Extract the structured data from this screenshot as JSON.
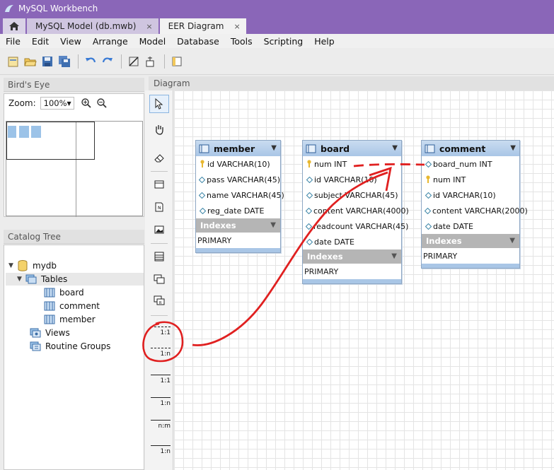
{
  "window": {
    "title": "MySQL Workbench"
  },
  "tabs": [
    {
      "label": "MySQL Model (db.mwb)",
      "close": "×"
    },
    {
      "label": "EER Diagram",
      "close": "×"
    }
  ],
  "menu": [
    "File",
    "Edit",
    "View",
    "Arrange",
    "Model",
    "Database",
    "Tools",
    "Scripting",
    "Help"
  ],
  "birds_eye": {
    "title": "Bird's Eye",
    "zoom_label": "Zoom:",
    "zoom_value": "100%"
  },
  "catalog": {
    "title": "Catalog Tree",
    "schema": "mydb",
    "tables_label": "Tables",
    "tables": [
      "board",
      "comment",
      "member"
    ],
    "views_label": "Views",
    "routines_label": "Routine Groups"
  },
  "diagram": {
    "title": "Diagram",
    "relations": [
      "1:1",
      "1:n",
      "1:1",
      "1:n",
      "n:m",
      "1:n"
    ],
    "tables": {
      "member": {
        "name": "member",
        "columns": [
          {
            "text": "id VARCHAR(10)",
            "key": "pk"
          },
          {
            "text": "pass VARCHAR(45)",
            "key": "col"
          },
          {
            "text": "name VARCHAR(45)",
            "key": "col"
          },
          {
            "text": "reg_date DATE",
            "key": "col"
          }
        ],
        "indexes_label": "Indexes",
        "indexes": [
          "PRIMARY"
        ]
      },
      "board": {
        "name": "board",
        "columns": [
          {
            "text": "num INT",
            "key": "pk"
          },
          {
            "text": "id VARCHAR(10)",
            "key": "col"
          },
          {
            "text": "subject VARCHAR(45)",
            "key": "col"
          },
          {
            "text": "content VARCHAR(4000)",
            "key": "col"
          },
          {
            "text": "readcount VARCHAR(45)",
            "key": "col"
          },
          {
            "text": "date DATE",
            "key": "col"
          }
        ],
        "indexes_label": "Indexes",
        "indexes": [
          "PRIMARY"
        ]
      },
      "comment": {
        "name": "comment",
        "columns": [
          {
            "text": "board_num INT",
            "key": "col"
          },
          {
            "text": "num INT",
            "key": "pk"
          },
          {
            "text": "id VARCHAR(10)",
            "key": "col"
          },
          {
            "text": "content VARCHAR(2000)",
            "key": "col"
          },
          {
            "text": "date DATE",
            "key": "col"
          }
        ],
        "indexes_label": "Indexes",
        "indexes": [
          "PRIMARY"
        ]
      }
    }
  },
  "colors": {
    "titlebar": "#8a66b8",
    "annotation": "#e02020",
    "table_header": "#a9c6e6"
  }
}
